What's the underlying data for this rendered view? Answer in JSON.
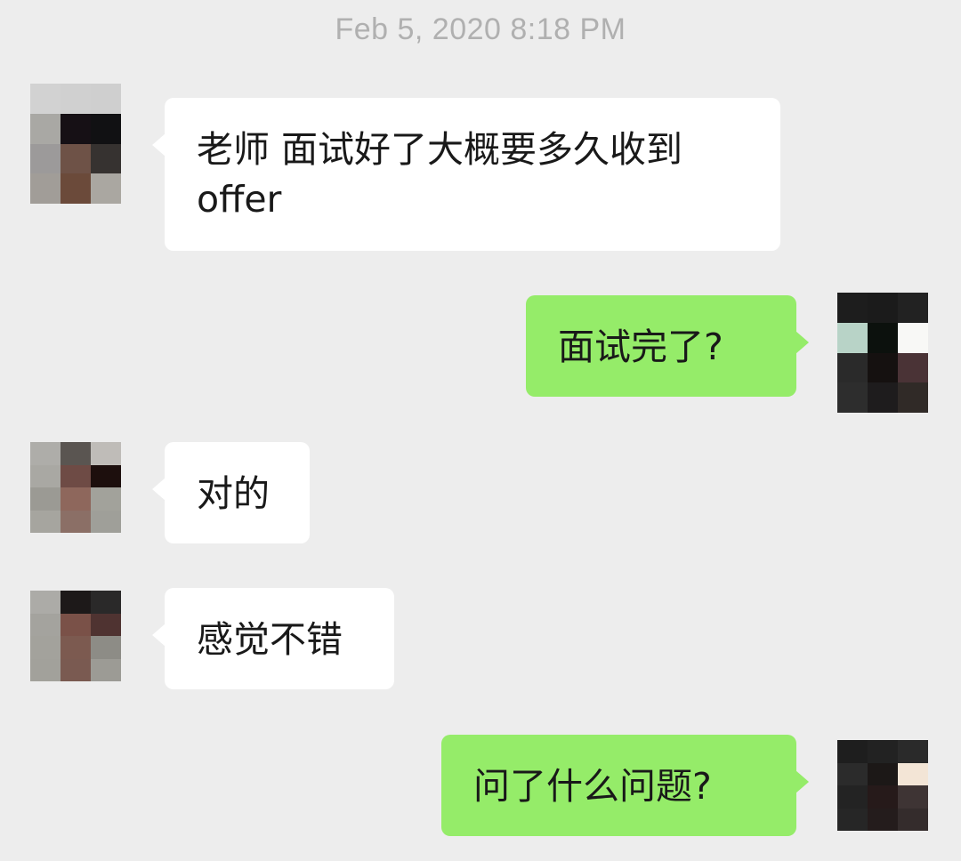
{
  "timestamp": "Feb 5, 2020 8:18 PM",
  "messages": [
    {
      "side": "in",
      "text": "老师 面试好了大概要多久收到\noffer"
    },
    {
      "side": "out",
      "text": "面试完了?"
    },
    {
      "side": "in",
      "text": "对的"
    },
    {
      "side": "in",
      "text": "感觉不错"
    },
    {
      "side": "out",
      "text": "问了什么问题?"
    }
  ],
  "colors": {
    "background": "#ededed",
    "incoming_bubble": "#ffffff",
    "outgoing_bubble": "#95ec69",
    "timestamp_text": "#b0b0b0"
  },
  "avatar_pixels": {
    "contact_1": [
      "#d2d2d2",
      "#d0d0d0",
      "#cfcfcf",
      "#a9a8a4",
      "#161015",
      "#111113",
      "#9c9a9a",
      "#6e5247",
      "#363230",
      "#a19d98",
      "#6b4a3a",
      "#aaa7a1"
    ],
    "self_1": [
      "#1d1d1d",
      "#1b1b1b",
      "#222222",
      "#b8d3c7",
      "#0c110d",
      "#f8f8f6",
      "#2a2a2a",
      "#151110",
      "#4a3336",
      "#2d2d2d",
      "#1e1c1d",
      "#302a27"
    ],
    "contact_2": [
      "#aeada9",
      "#5a5551",
      "#bfbcb8",
      "#a9a8a3",
      "#6e4b45",
      "#1d0f0d",
      "#9b9a94",
      "#8e675c",
      "#a2a29b",
      "#a6a59f",
      "#8b6f66",
      "#9f9f99"
    ],
    "contact_3": [
      "#acaba7",
      "#1d1919",
      "#2a2929",
      "#a4a39e",
      "#7a5148",
      "#4f3331",
      "#a3a29c",
      "#7c5a50",
      "#8d8c86",
      "#a2a19b",
      "#7a5a51",
      "#9c9b95"
    ],
    "self_2": [
      "#1e1e1e",
      "#222222",
      "#2a2a2a",
      "#2b2b2b",
      "#1c1817",
      "#f3e5d6",
      "#232323",
      "#261a1a",
      "#3e3434",
      "#262626",
      "#241c1c",
      "#342c2c"
    ]
  }
}
